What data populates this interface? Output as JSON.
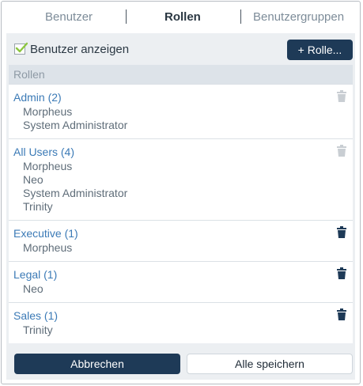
{
  "tabs": [
    {
      "label": "Benutzer",
      "active": false
    },
    {
      "label": "Rollen",
      "active": true
    },
    {
      "label": "Benutzergruppen",
      "active": false
    }
  ],
  "toolbar": {
    "show_users_label": "Benutzer anzeigen",
    "show_users_checked": true,
    "add_role_label": "+ Rolle..."
  },
  "list": {
    "header": "Rollen",
    "roles": [
      {
        "name": "Admin (2)",
        "members": [
          "Morpheus",
          "System Administrator"
        ],
        "delete_enabled": false
      },
      {
        "name": "All Users (4)",
        "members": [
          "Morpheus",
          "Neo",
          "System Administrator",
          "Trinity"
        ],
        "delete_enabled": false
      },
      {
        "name": "Executive (1)",
        "members": [
          "Morpheus"
        ],
        "delete_enabled": true
      },
      {
        "name": "Legal (1)",
        "members": [
          "Neo"
        ],
        "delete_enabled": true
      },
      {
        "name": "Sales (1)",
        "members": [
          "Trinity"
        ],
        "delete_enabled": true
      }
    ]
  },
  "footer": {
    "cancel_label": "Abbrechen",
    "save_all_label": "Alle speichern"
  },
  "colors": {
    "primary": "#1e3a57",
    "link": "#3b7ab6",
    "checkmark": "#8cc63f",
    "trash_enabled": "#1e3a57",
    "trash_disabled": "#c9ced3"
  }
}
